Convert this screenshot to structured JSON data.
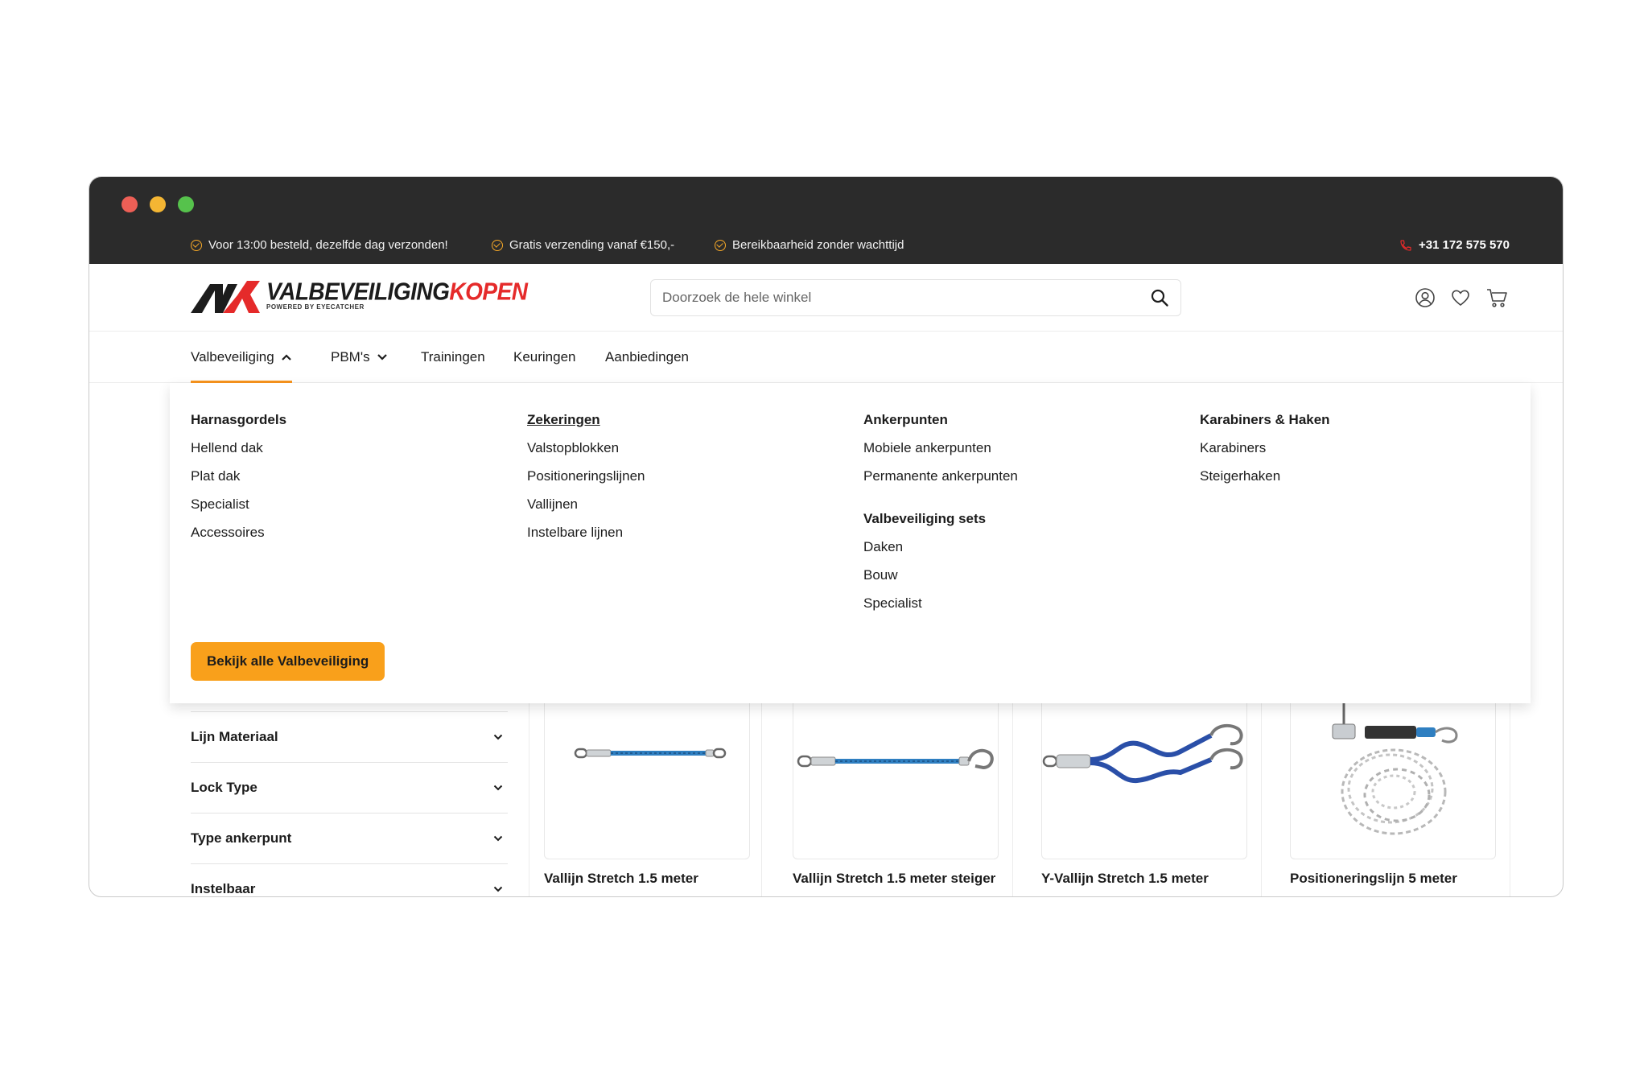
{
  "usp_bar": {
    "items": [
      "Voor 13:00 besteld, dezelfde dag verzonden!",
      "Gratis verzending vanaf €150,-",
      "Bereikbaarheid zonder wachttijd"
    ],
    "phone": "+31 172 575 570"
  },
  "header": {
    "logo_main_black": "VALBEVEILIGING",
    "logo_main_red": "KOPEN",
    "logo_sub": "POWERED BY EYECATCHER",
    "search_placeholder": "Doorzoek de hele winkel"
  },
  "nav": {
    "items": [
      "Valbeveiliging",
      "PBM's",
      "Trainingen",
      "Keuringen",
      "Aanbiedingen"
    ]
  },
  "mega_menu": {
    "col1": {
      "head": "Harnasgordels",
      "links": [
        "Hellend dak",
        "Plat dak",
        "Specialist",
        "Accessoires"
      ]
    },
    "col2": {
      "head": "Zekeringen",
      "links": [
        "Valstopblokken",
        "Positioneringslijnen",
        "Vallijnen",
        "Instelbare lijnen"
      ]
    },
    "col3": {
      "head": "Ankerpunten",
      "links": [
        "Mobiele ankerpunten",
        "Permanente ankerpunten"
      ],
      "head2": "Valbeveiliging sets",
      "links2": [
        "Daken",
        "Bouw",
        "Specialist"
      ]
    },
    "col4": {
      "head": "Karabiners & Haken",
      "links": [
        "Karabiners",
        "Steigerhaken"
      ]
    },
    "cta": "Bekijk alle Valbeveiliging"
  },
  "filters": [
    "Lijn Materiaal",
    "Lock Type",
    "Type ankerpunt",
    "Instelbaar"
  ],
  "products": [
    "Vallijn Stretch 1.5 meter",
    "Vallijn Stretch 1.5 meter steiger",
    "Y-Vallijn Stretch 1.5 meter",
    "Positioneringslijn 5 meter"
  ],
  "colors": {
    "accent": "#f9a01b",
    "brand_red": "#e52a2a",
    "titlebar": "#2b2b2b"
  }
}
